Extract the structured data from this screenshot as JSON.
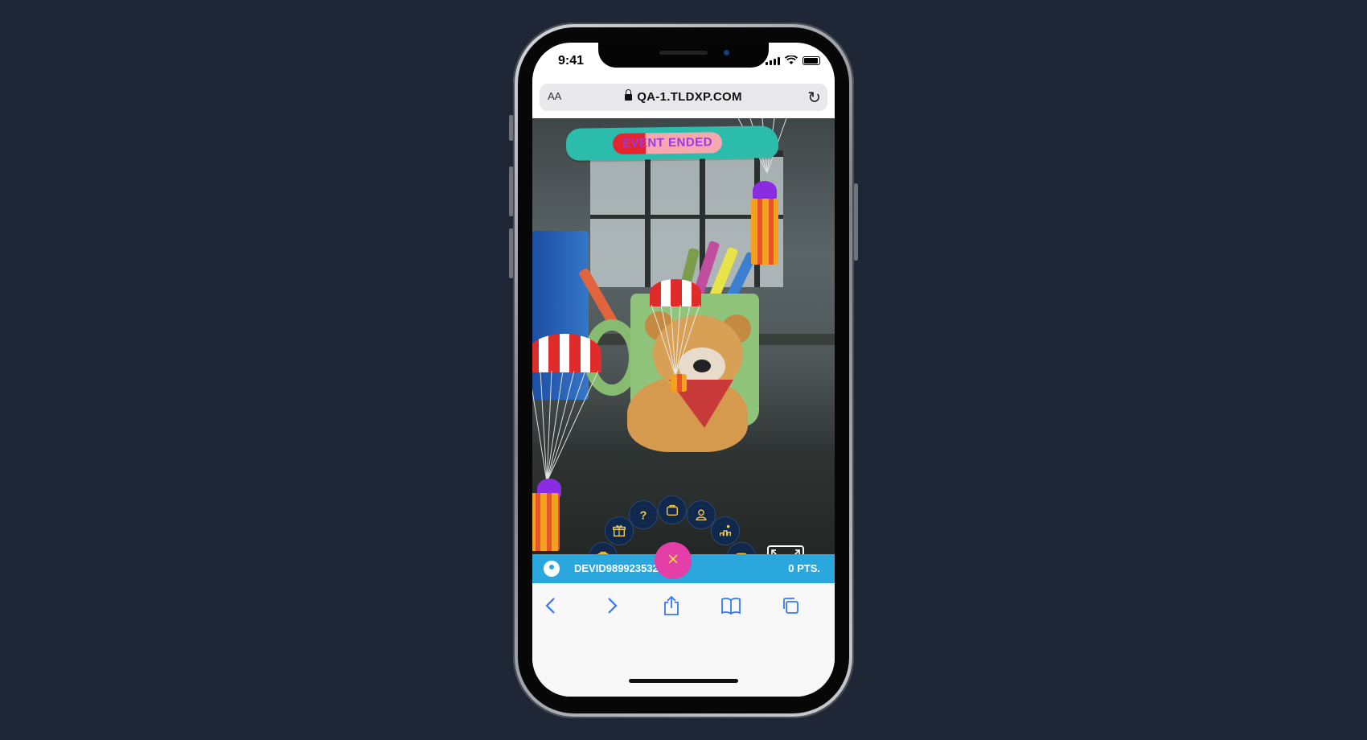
{
  "status_bar": {
    "time": "9:41"
  },
  "browser": {
    "text_size_label": "AA",
    "url": "QA-1.TLDXP.COM",
    "reload_icon": "reload-icon",
    "toolbar_icons": [
      "back-icon",
      "forward-icon",
      "share-icon",
      "bookmarks-icon",
      "tabs-icon"
    ]
  },
  "event": {
    "status_label": "EVENT ENDED"
  },
  "game_menu": {
    "items": [
      "bag-icon",
      "gift-icon",
      "help-icon",
      "shop-icon",
      "profile-icon",
      "leaderboard-icon",
      "gamepad-icon"
    ],
    "close_label": "×"
  },
  "user": {
    "username": "DEVID98992353225",
    "points": "0 PTS."
  },
  "colors": {
    "background": "#1f2635",
    "banner": "#2bbcab",
    "user_bar": "#2aa8dd",
    "menu_button": "#11284d",
    "close_button": "#e43fa8",
    "icon_accent": "#f2c64c"
  }
}
